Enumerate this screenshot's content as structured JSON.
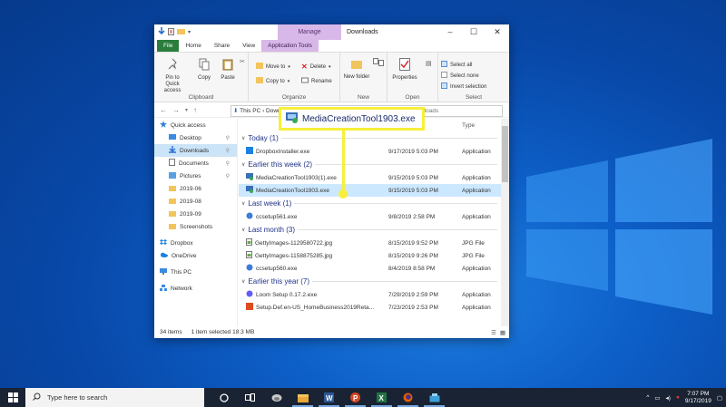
{
  "window": {
    "title": "Downloads",
    "manage_tab": "Manage",
    "tabs": [
      "File",
      "Home",
      "Share",
      "View",
      "Application Tools"
    ]
  },
  "ribbon": {
    "clipboard": {
      "label": "Clipboard",
      "pin": "Pin to Quick access",
      "copy": "Copy",
      "paste": "Paste"
    },
    "organize": {
      "label": "Organize",
      "move_to": "Move to",
      "copy_to": "Copy to",
      "delete": "Delete",
      "rename": "Rename"
    },
    "new": {
      "label": "New",
      "new_folder": "New folder"
    },
    "open": {
      "label": "Open",
      "properties": "Properties"
    },
    "select": {
      "label": "Select",
      "select_all": "Select all",
      "select_none": "Select none",
      "invert": "Invert selection"
    }
  },
  "address": {
    "path": "This PC  ›  Downl",
    "search_placeholder": "Downloads"
  },
  "columns": {
    "date_suffix": "d",
    "type": "Type"
  },
  "nav": [
    {
      "label": "Quick access",
      "icon": "star-icon",
      "pinned": false,
      "selected": false
    },
    {
      "label": "Desktop",
      "icon": "desktop-icon",
      "pinned": true,
      "selected": false
    },
    {
      "label": "Downloads",
      "icon": "download-icon",
      "pinned": true,
      "selected": true
    },
    {
      "label": "Documents",
      "icon": "documents-icon",
      "pinned": true,
      "selected": false
    },
    {
      "label": "Pictures",
      "icon": "pictures-icon",
      "pinned": true,
      "selected": false
    },
    {
      "label": "2019-06",
      "icon": "folder-icon",
      "pinned": false,
      "selected": false
    },
    {
      "label": "2019-08",
      "icon": "folder-icon",
      "pinned": false,
      "selected": false
    },
    {
      "label": "2019-09",
      "icon": "folder-icon",
      "pinned": false,
      "selected": false
    },
    {
      "label": "Screenshots",
      "icon": "folder-icon",
      "pinned": false,
      "selected": false
    },
    {
      "label": "Dropbox",
      "icon": "dropbox-icon",
      "pinned": false,
      "selected": false
    },
    {
      "label": "OneDrive",
      "icon": "onedrive-icon",
      "pinned": false,
      "selected": false
    },
    {
      "label": "This PC",
      "icon": "computer-icon",
      "pinned": false,
      "selected": false
    },
    {
      "label": "Network",
      "icon": "network-icon",
      "pinned": false,
      "selected": false
    }
  ],
  "groups": [
    {
      "label": "Today (1)",
      "rows": [
        {
          "name": "DropboxInstaller.exe",
          "date": "9/17/2019 5:03 PM",
          "type": "Application",
          "selected": false
        }
      ]
    },
    {
      "label": "Earlier this week (2)",
      "rows": [
        {
          "name": "MediaCreationTool1903(1).exe",
          "date": "9/15/2019 5:03 PM",
          "type": "Application",
          "selected": false
        },
        {
          "name": "MediaCreationTool1903.exe",
          "date": "9/15/2019 5:03 PM",
          "type": "Application",
          "selected": true
        }
      ]
    },
    {
      "label": "Last week (1)",
      "rows": [
        {
          "name": "ccsetup561.exe",
          "date": "9/8/2019 2:58 PM",
          "type": "Application",
          "selected": false
        }
      ]
    },
    {
      "label": "Last month (3)",
      "rows": [
        {
          "name": "GettyImages-1129580722.jpg",
          "date": "8/15/2019 9:52 PM",
          "type": "JPG File",
          "selected": false
        },
        {
          "name": "GettyImages-1158875285.jpg",
          "date": "8/15/2019 9:26 PM",
          "type": "JPG File",
          "selected": false
        },
        {
          "name": "ccsetup560.exe",
          "date": "8/4/2019 8:58 PM",
          "type": "Application",
          "selected": false
        }
      ]
    },
    {
      "label": "Earlier this year (7)",
      "rows": [
        {
          "name": "Loom Setup 0.17.2.exe",
          "date": "7/29/2019 2:59 PM",
          "type": "Application",
          "selected": false
        },
        {
          "name": "Setup.Def.en-US_HomeBusiness2019Reta...",
          "date": "7/23/2019 2:53 PM",
          "type": "Application",
          "selected": false
        }
      ]
    }
  ],
  "status": {
    "count": "34 items",
    "selection": "1 item selected  18.3 MB"
  },
  "callout": {
    "text": "MediaCreationTool1903.exe",
    "color": "#f7ef3a"
  },
  "taskbar": {
    "search_placeholder": "Type here to search",
    "apps": [
      "cortana-icon",
      "task-view-icon",
      "edge-icon",
      "file-explorer-icon",
      "word-icon",
      "powerpoint-icon",
      "excel-icon",
      "firefox-icon",
      "snipping-icon"
    ],
    "time": "7:07 PM",
    "date": "9/17/2019"
  }
}
